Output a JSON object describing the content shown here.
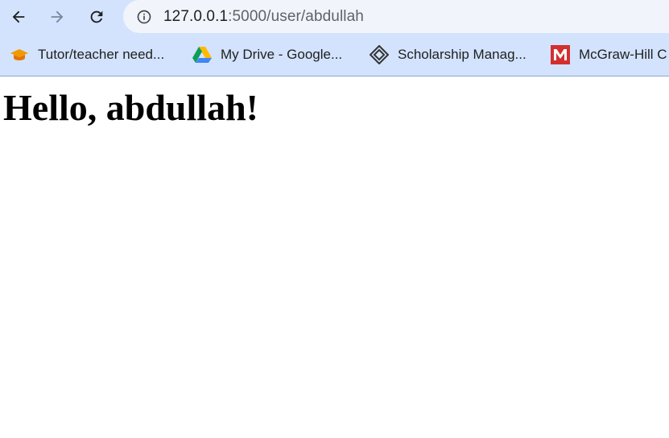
{
  "browser": {
    "url_host": "127.0.0.1",
    "url_rest": ":5000/user/abdullah",
    "bookmarks": [
      {
        "label": "Tutor/teacher need...",
        "icon": "graduation-cap-icon"
      },
      {
        "label": "My Drive - Google...",
        "icon": "google-drive-icon"
      },
      {
        "label": "Scholarship Manag...",
        "icon": "diamond-logo-icon"
      },
      {
        "label": "McGraw-Hill C",
        "icon": "mcgraw-hill-icon"
      }
    ],
    "colors": {
      "chrome_bg": "#d3e3fd",
      "omnibox_bg": "#f1f5fb",
      "mcgraw_red": "#d32f2f"
    }
  },
  "page": {
    "heading": "Hello, abdullah!"
  }
}
